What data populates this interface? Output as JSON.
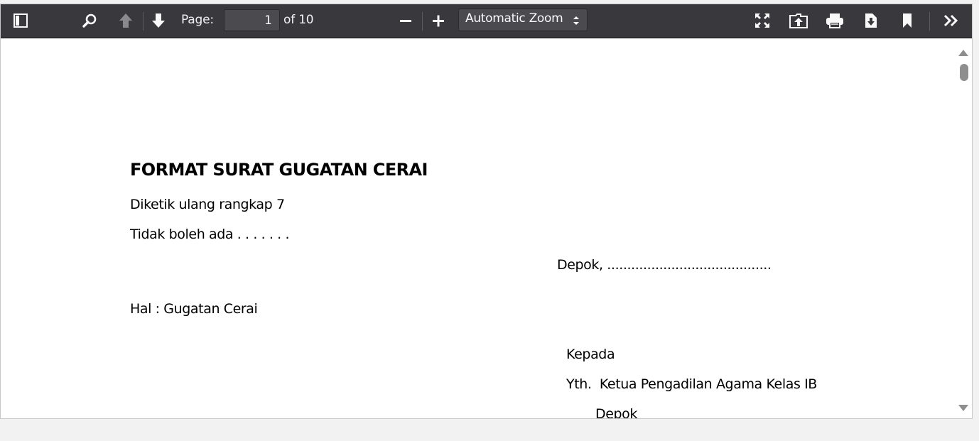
{
  "toolbar": {
    "icons": {
      "sidebar": "sidebar-toggle-icon",
      "search": "search-icon",
      "prev": "arrow-up-icon",
      "next": "arrow-down-icon",
      "zoom_out": "minus-icon",
      "zoom_in": "plus-icon",
      "presentation": "fullscreen-icon",
      "open": "open-file-icon",
      "print": "print-icon",
      "download": "download-icon",
      "bookmark": "bookmark-icon",
      "tools": "double-chevron-right-icon"
    },
    "page_label": "Page:",
    "page_number": "1",
    "page_total": "of 10",
    "zoom_selected": "Automatic Zoom"
  },
  "document": {
    "title": "FORMAT SURAT GUGATAN CERAI",
    "line1": "Diketik ulang rangkap 7",
    "line2": "Tidak boleh ada . . . . . . .",
    "place_date": "Depok, .........................................",
    "subject": "Hal : Gugatan Cerai",
    "to": "Kepada",
    "recipient": "Yth.  Ketua Pengadilan Agama Kelas IB",
    "city": "Depok"
  },
  "colors": {
    "toolbar_bg": "#38383d",
    "toolbar_fg": "#f9f9fa",
    "page_bg": "#ffffff"
  }
}
